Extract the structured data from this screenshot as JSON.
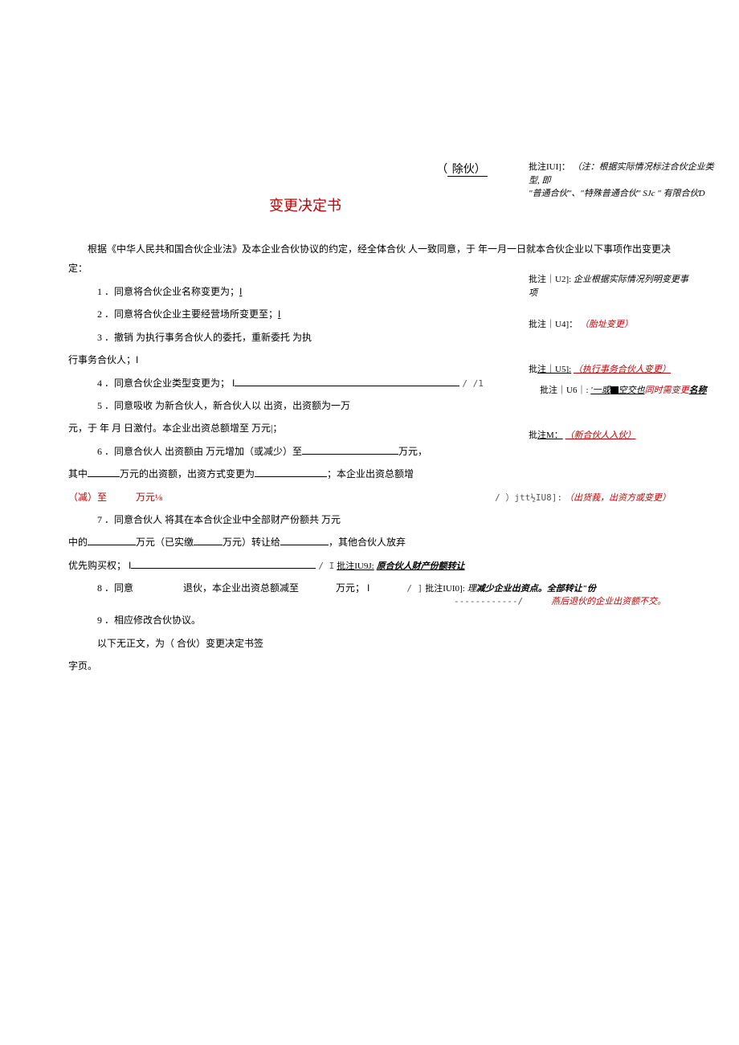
{
  "header": {
    "removal_paren_open": "（",
    "removal_text": " 除伙）",
    "title": "变更决定书"
  },
  "intro": "根据《中华人民共和国合伙企业法》及本企业合伙协议的约定，经全体合伙 人一致同意，于 年一月一日就本合伙企业以下事项作出变更决定：",
  "items": {
    "i1": "1 ．同意将合伙企业名称变更为；",
    "i1_tail": "I",
    "i2": "2 ．同意将合伙企业主要经营场所变更至；",
    "i2_tail": "I",
    "i3": "3 ．撤销 为执行事务合伙人的委托，重新委托 为执",
    "i3_cont": "行事务合伙人；",
    "i3_cont_tail": "I",
    "i4": "4 ．同意合伙企业类型变更为；",
    "i4_tail": "I",
    "i4_tail2": "/ /1",
    "i5": "5 ．同意吸收 为新合伙人，新合伙人以 出资，出资额为一万",
    "i5_cont_a": "元，于 年 月 日激付。本企业出资总额增至 万元",
    "i5_cont_b": "|；",
    "i6": "6 ．同意合伙人 出资额由 万元增加（或减少）至",
    "i6_tail": "万元，",
    "i6_cont_a": "其中",
    "i6_cont_b": "万元的出资额，出资方式变更为",
    "i6_cont_c": "；本企业出资总额增",
    "i6_red_a": "（减）至",
    "i6_red_b": "万元⅛",
    "i6_tail2": "/ ）jtt½IU8]:",
    "i6_ann": "（出货莪，出资方或变更）",
    "i7": "7 ．同意合伙人 将其在本合伙企业中全部财产份额共 万元",
    "i7_cont_a": "中的",
    "i7_cont_b": "万元（已实缴",
    "i7_cont_c": "万元）转让给",
    "i7_cont_d": "，其他合伙人放弃",
    "i7_cont2_a": "优先购买权；",
    "i7_cont2_tail": "I",
    "i7_ann_prefix": "/ I",
    "i7_ann_label": "批注IU9J:",
    "i7_ann_text": "原合伙人财产份额转让",
    "i8": "8 ．同意",
    "i8_b": "退伙，本企业出资总额减至",
    "i8_c": "万元；",
    "i8_tail": "I",
    "i8_connector": "------------/",
    "i8_ann_prefix": "/ ]",
    "i8_ann_label": "批注IUI0]:",
    "i8_ann_text_a": "理",
    "i8_ann_text_b": "减少企业出资点。全部转让\"份",
    "i8_ann_line2": "燕后退伙的企业出资额不交。",
    "i9": "9 ．相应修改合伙协议。",
    "closing_a": "以下无正文，为（ 合伙）变更决定书签",
    "closing_b": "字页。"
  },
  "annotations": {
    "u1": {
      "label": "批注IUI]：",
      "text_a": "（注：根据实际情况标注合伙企业类型, 即",
      "text_b": "\"普通合伙\"、\"特殊普通合伙\" SJc \" 有限合伙D"
    },
    "u2": {
      "label": "批注｜U2]:",
      "text_a": "企业根据实际情况列明变更事",
      "text_b": "项"
    },
    "u4": {
      "label": "批注｜U4]：",
      "text": "（胎址变更）"
    },
    "u5": {
      "label_a": "批",
      "label_b": "注｜U5]:",
      "text": "（执行事务合伙人变更）"
    },
    "u6": {
      "label": "批注｜U6｜:",
      "text_a": "'一或",
      "text_b": "空交也",
      "text_c": "同时需变更",
      "text_d": "名称"
    },
    "m": {
      "label_a": "批",
      "label_b": "注M：",
      "text": "（新合伙人入伙）"
    }
  }
}
